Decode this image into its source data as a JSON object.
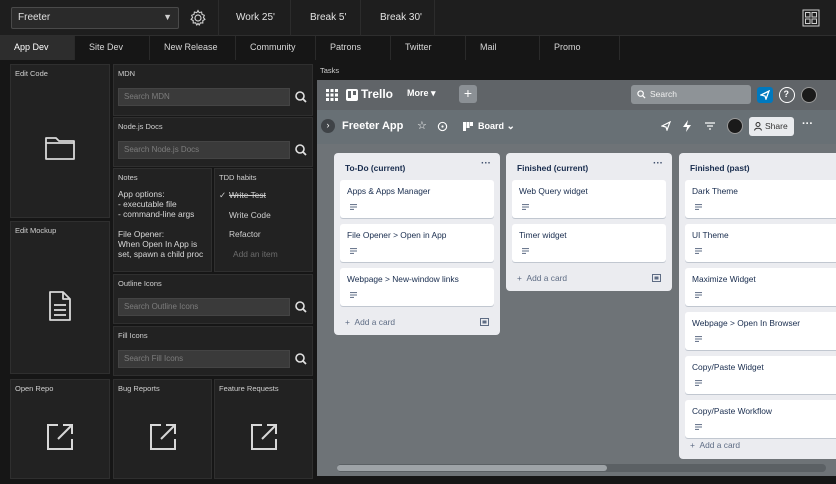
{
  "topbar": {
    "workspace": "Freeter",
    "timers": [
      "Work 25'",
      "Break 5'",
      "Break 30'"
    ]
  },
  "tabs": [
    "App Dev",
    "Site Dev",
    "New Release",
    "Community",
    "Patrons",
    "Twitter",
    "Mail",
    "Promo"
  ],
  "panels": {
    "edit_code": "Edit Code",
    "edit_mockup": "Edit Mockup",
    "open_repo": "Open Repo",
    "bug_reports": "Bug Reports",
    "feature_requests": "Feature Requests",
    "mdn": {
      "title": "MDN",
      "placeholder": "Search MDN"
    },
    "nodejs": {
      "title": "Node.js Docs",
      "placeholder": "Search Node.js Docs"
    },
    "outline_icons": {
      "title": "Outline Icons",
      "placeholder": "Search Outline Icons"
    },
    "fill_icons": {
      "title": "Fill Icons",
      "placeholder": "Search Fill Icons"
    },
    "notes": {
      "title": "Notes",
      "text": "App options:\n- executable file\n- command-line args\n\nFile Opener:\nWhen Open In App is\nset, spawn a child proc"
    },
    "tdd": {
      "title": "TDD habits",
      "items": [
        "Write Test",
        "Write Code",
        "Refactor"
      ],
      "add": "Add an item"
    },
    "tasks": "Tasks"
  },
  "trello": {
    "logo": "Trello",
    "more": "More",
    "search": "Search",
    "board_name": "Freeter App",
    "board_view": "Board",
    "share": "Share",
    "add_card": "Add a card",
    "lists": [
      {
        "title": "To-Do (current)",
        "cards": [
          "Apps & Apps Manager",
          "File Opener > Open in App",
          "Webpage > New-window links"
        ]
      },
      {
        "title": "Finished (current)",
        "cards": [
          "Web Query widget",
          "Timer widget"
        ]
      },
      {
        "title": "Finished (past)",
        "cards": [
          "Dark Theme",
          "UI Theme",
          "Maximize Widget",
          "Webpage > Open In Browser",
          "Copy/Paste Widget",
          "Copy/Paste Workflow"
        ]
      }
    ]
  },
  "colors": {
    "trello_bg": "#6e7377",
    "accent_blue": "#0079bf",
    "list_bg": "#ebecf0"
  }
}
